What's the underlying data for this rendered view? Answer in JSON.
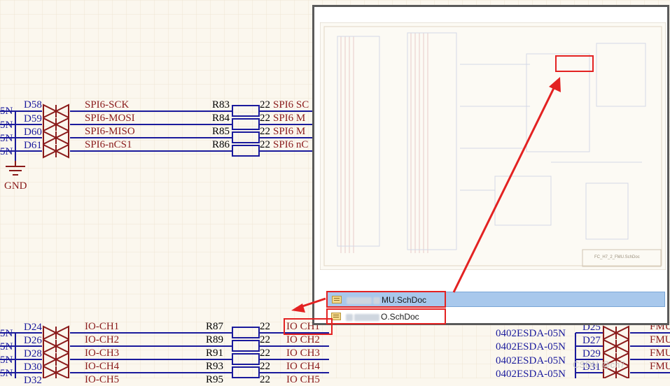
{
  "schematic": {
    "top_group": {
      "diodes": [
        {
          "ref": "D58",
          "net": "SPI6-SCK",
          "res": "R83",
          "val": "22",
          "right": "SPI6  SC"
        },
        {
          "ref": "D59",
          "net": "SPI6-MOSI",
          "res": "R84",
          "val": "22",
          "right": "SPI6  M"
        },
        {
          "ref": "D60",
          "net": "SPI6-MISO",
          "res": "R85",
          "val": "22",
          "right": "SPI6  M"
        },
        {
          "ref": "D61",
          "net": "SPI6-nCS1",
          "res": "R86",
          "val": "22",
          "right": "SPI6  nC"
        }
      ],
      "left_stub": "5N",
      "ground": "GND"
    },
    "bottom_group": {
      "diodes": [
        {
          "ref": "D24",
          "net": "IO-CH1",
          "res": "R87",
          "val": "22",
          "right": "IO  CH1"
        },
        {
          "ref": "D26",
          "net": "IO-CH2",
          "res": "R89",
          "val": "22",
          "right": "IO  CH2"
        },
        {
          "ref": "D28",
          "net": "IO-CH3",
          "res": "R91",
          "val": "22",
          "right": "IO  CH3"
        },
        {
          "ref": "D30",
          "net": "IO-CH4",
          "res": "R93",
          "val": "22",
          "right": "IO  CH4"
        },
        {
          "ref": "D32",
          "net": "IO-CH5",
          "res": "R95",
          "val": "22",
          "right": "IO  CH5"
        }
      ],
      "left_stub": "5N"
    },
    "right_group": {
      "part": "0402ESDA-05N",
      "diodes": [
        {
          "ref": "D25",
          "net": "FMU"
        },
        {
          "ref": "D27",
          "net": "FMU"
        },
        {
          "ref": "D29",
          "net": "FMU"
        },
        {
          "ref": "D31",
          "net": "FMU"
        }
      ]
    }
  },
  "popup": {
    "title_block": "FC_H7_2_FMU.SchDoc",
    "files": [
      {
        "visible_name": "MU.SchDoc",
        "selected": true
      },
      {
        "visible_name": "O.SchDoc",
        "selected": false
      }
    ]
  },
  "annotation": {
    "color": "#e32222"
  },
  "watermark": "CSDN @ch7"
}
